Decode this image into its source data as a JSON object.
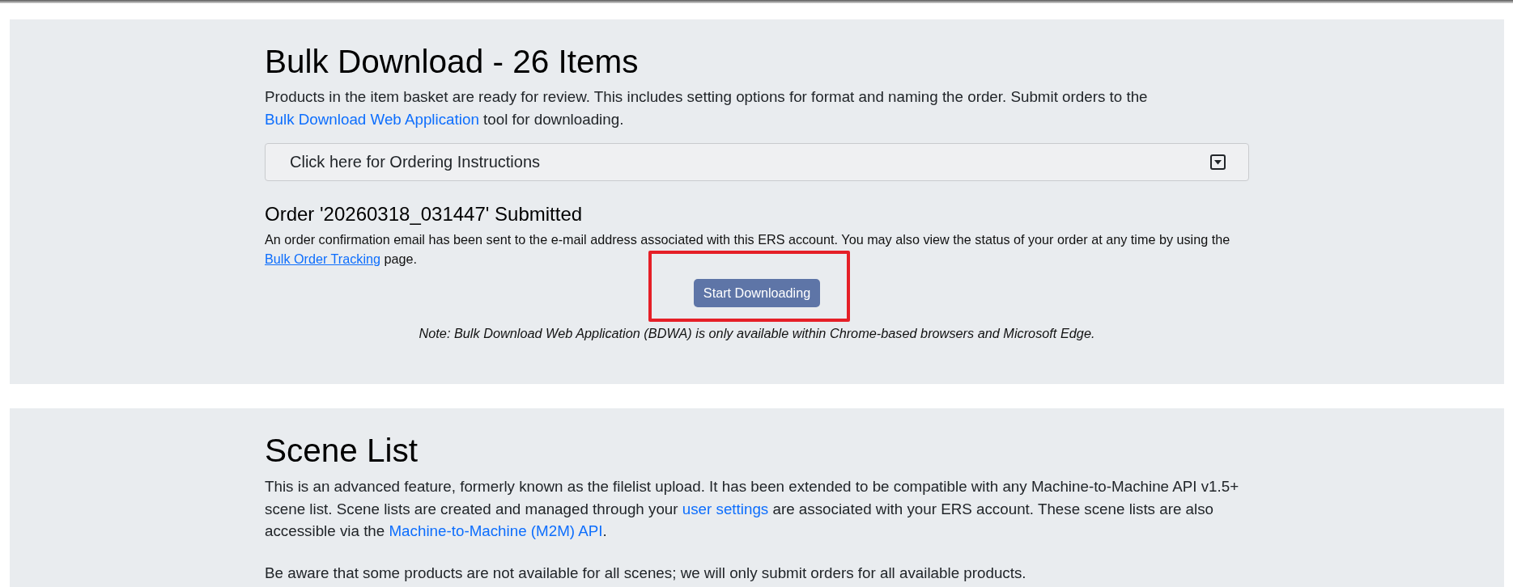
{
  "bulk_download": {
    "title": "Bulk Download - 26 Items",
    "intro": [
      {
        "kind": "text",
        "text": "Products in the item basket are ready for review. This includes setting options for format and naming the order. Submit orders to the "
      },
      {
        "kind": "link",
        "text": "Bulk Download Web Application"
      },
      {
        "kind": "text",
        "text": " tool for downloading."
      }
    ],
    "instructions_toggle": {
      "label": "Click here for Ordering Instructions",
      "expanded": false
    },
    "order": {
      "title": "Order '20260318_031447' Submitted",
      "message": [
        {
          "kind": "text",
          "text": "An order confirmation email has been sent to the e-mail address associated with this ERS account. You may also view the status of your order at any time by using the "
        },
        {
          "kind": "link",
          "text": "Bulk Order Tracking"
        },
        {
          "kind": "text",
          "text": " page."
        }
      ],
      "start_button": {
        "label": "Start Downloading",
        "highlighted": true
      },
      "note": "Note: Bulk Download Web Application (BDWA) is only available within Chrome-based browsers and Microsoft Edge."
    }
  },
  "scene_list": {
    "title": "Scene List",
    "paragraphs": [
      [
        {
          "kind": "text",
          "text": "This is an advanced feature, formerly known as the filelist upload. It has been extended to be compatible with any Machine-to-Machine API v1.5+ scene list. Scene lists are created and managed through your "
        },
        {
          "kind": "link",
          "text": "user settings"
        },
        {
          "kind": "text",
          "text": " are associated with your ERS account. These scene lists are also accessible via the "
        },
        {
          "kind": "link",
          "text": "Machine-to-Machine (M2M) API"
        },
        {
          "kind": "text",
          "text": "."
        }
      ],
      [
        {
          "kind": "text",
          "text": "Be aware that some products are not available for all scenes; we will only submit orders for all available products."
        }
      ]
    ]
  }
}
